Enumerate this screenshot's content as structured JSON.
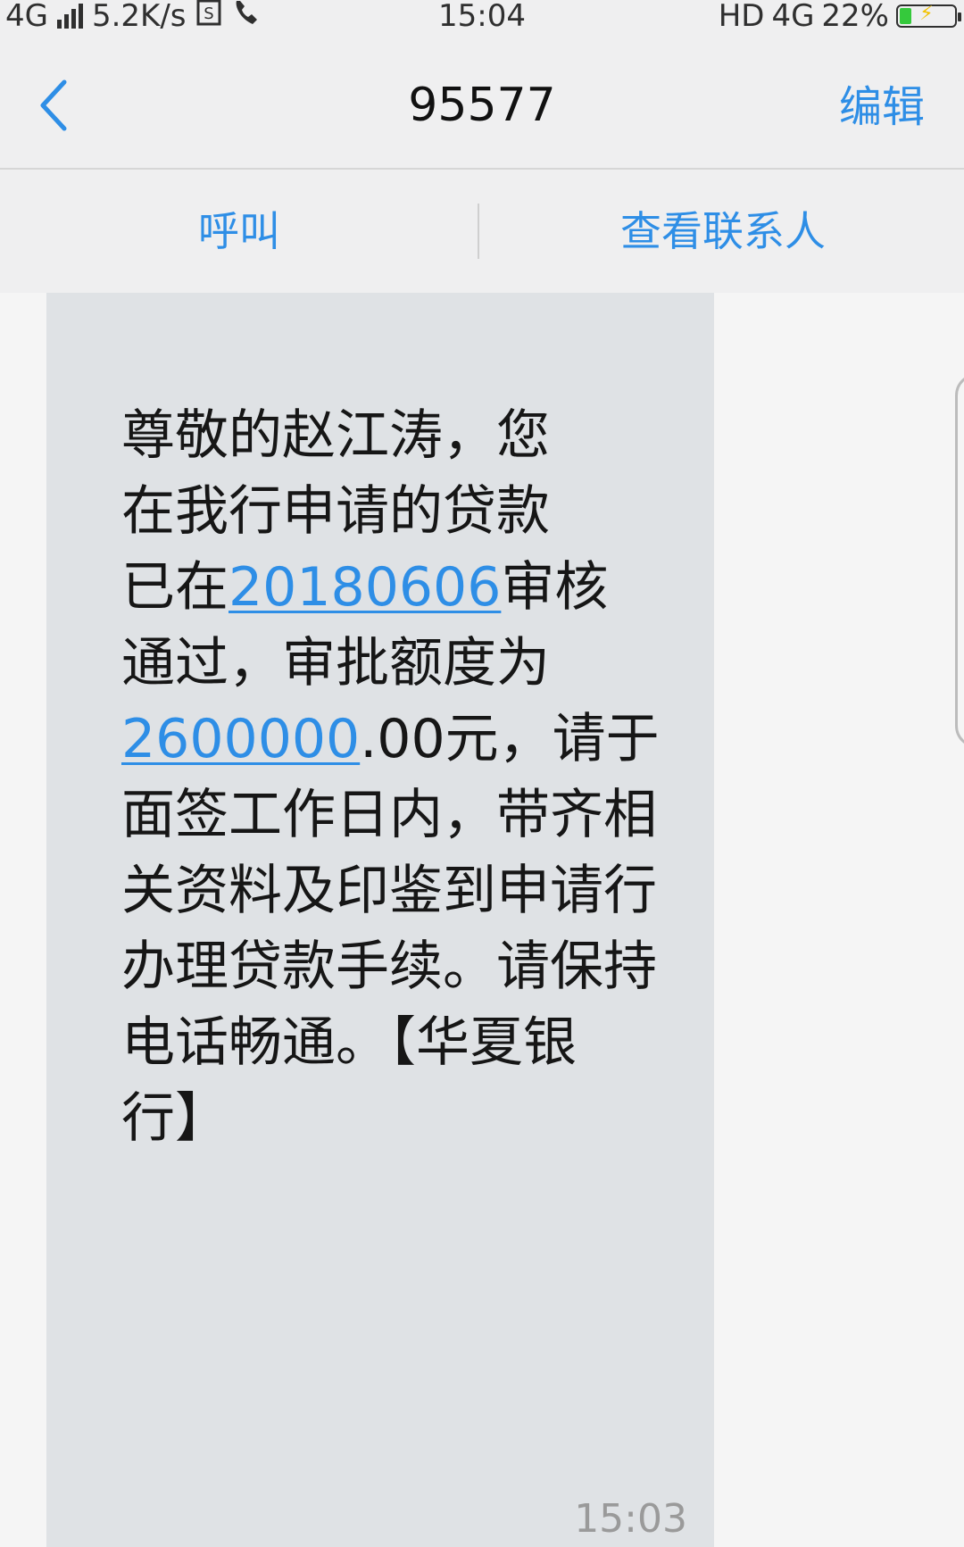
{
  "status_bar": {
    "network": "4G",
    "speed": "5.2K/s",
    "time": "15:04",
    "hd": "HD",
    "network_right": "4G",
    "battery_percent": "22%",
    "battery_level": 0.22,
    "icons": [
      "signal-icon",
      "sim-icon",
      "call-icon",
      "battery-icon"
    ]
  },
  "nav": {
    "title": "95577",
    "edit_label": "编辑",
    "back_icon": "chevron-left-icon"
  },
  "actions": {
    "call_label": "呼叫",
    "contact_label": "查看联系人"
  },
  "message": {
    "part1": "尊敬的赵江涛，您\n在我行申请的贷款\n已在",
    "date_link": "20180606",
    "part2": "审核\n通过，审批额度为\n",
    "amount_link": "2600000",
    "part3": ".00元，请于\n面签工作日内，带齐相\n关资料及印鉴到申请行\n办理贷款手续。请保持\n电话畅通。【华夏银\n行】",
    "time": "15:03"
  },
  "colors": {
    "accent": "#2e8ee6",
    "bubble": "#dfe2e5",
    "battery_fill": "#35c93c"
  }
}
